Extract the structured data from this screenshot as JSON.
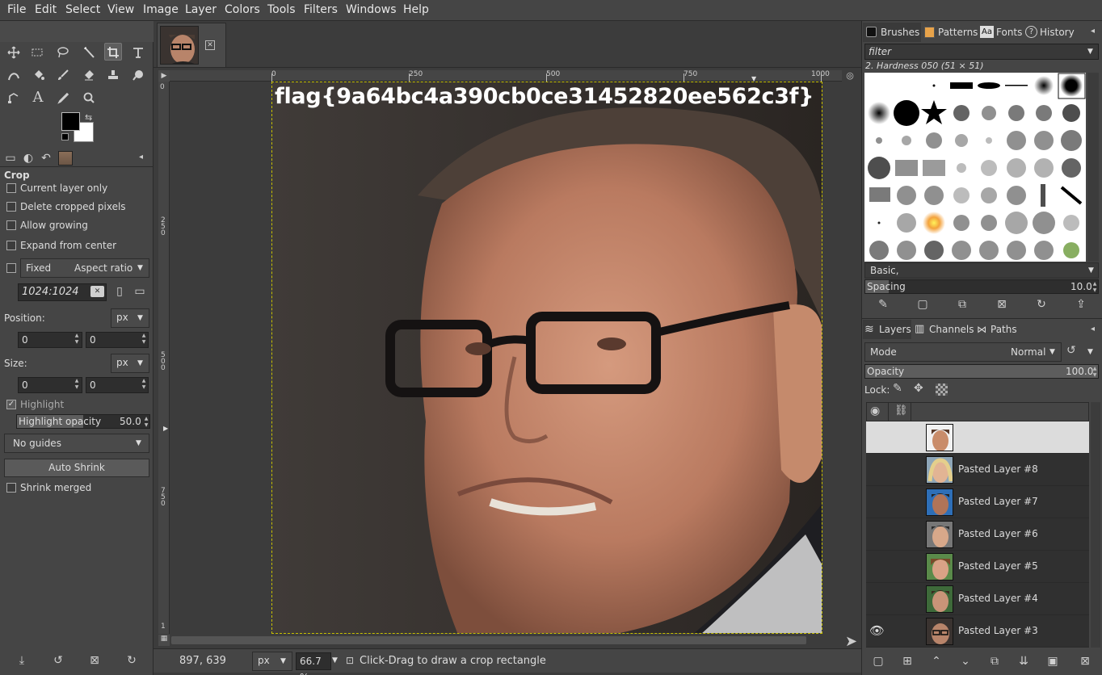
{
  "menubar": {
    "items": [
      "File",
      "Edit",
      "Select",
      "View",
      "Image",
      "Layer",
      "Colors",
      "Tools",
      "Filters",
      "Windows",
      "Help"
    ]
  },
  "toolbox": {
    "tool_rows": [
      [
        "move-icon",
        "rect-select-icon",
        "lasso-icon",
        "fuzzy-select-icon",
        "crop-icon",
        "unified-transform-icon"
      ],
      [
        "warp-icon",
        "bucket-fill-icon",
        "paintbrush-icon",
        "eraser-icon",
        "clone-icon",
        "smudge-icon"
      ],
      [
        "paths-icon",
        "text-icon",
        "color-picker-icon",
        "zoom-icon"
      ]
    ],
    "fg_color": "#000000",
    "bg_color": "#ffffff"
  },
  "tool_options": {
    "title": "Crop",
    "current_layer_only": "Current layer only",
    "delete_cropped_pixels": "Delete cropped pixels",
    "allow_growing": "Allow growing",
    "expand_from_center": "Expand from center",
    "fixed_label": "Fixed",
    "aspect_ratio": "Aspect ratio",
    "ratio_value": "1024:1024",
    "position_label": "Position:",
    "position_unit": "px",
    "position_x": "0",
    "position_y": "0",
    "size_label": "Size:",
    "size_unit": "px",
    "size_w": "0",
    "size_h": "0",
    "highlight": "Highlight",
    "highlight_opacity_label": "Highlight opacity",
    "highlight_opacity_value": "50.0",
    "guides": "No guides",
    "auto_shrink": "Auto Shrink",
    "shrink_merged": "Shrink merged",
    "highlight_checked": true
  },
  "canvas": {
    "flag_text": "flag{9a64bc4a390cb0ce31452820ee562c3f}",
    "ruler_h": [
      "0",
      "250",
      "500",
      "750",
      "1000"
    ],
    "ruler_v": [
      "0",
      "250",
      "500",
      "750",
      "1"
    ]
  },
  "status": {
    "coords": "897, 639",
    "unit": "px",
    "zoom": "66.7 %",
    "message": "Click-Drag to draw a crop rectangle"
  },
  "brushes_panel": {
    "tabs": [
      "Brushes",
      "Patterns",
      "Fonts",
      "History"
    ],
    "filter_placeholder": "filter",
    "brush_name": "2. Hardness 050 (51 × 51)",
    "preset": "Basic,",
    "spacing_label": "Spacing",
    "spacing_value": "10.0"
  },
  "layers_panel": {
    "tabs": [
      "Layers",
      "Channels",
      "Paths"
    ],
    "mode_label": "Mode",
    "mode_value": "Normal",
    "opacity_label": "Opacity",
    "opacity_value": "100.0",
    "lock_label": "Lock:",
    "layers": [
      {
        "name": "",
        "selected": true,
        "visible": false
      },
      {
        "name": "Pasted Layer #8",
        "selected": false,
        "visible": false
      },
      {
        "name": "Pasted Layer #7",
        "selected": false,
        "visible": false
      },
      {
        "name": "Pasted Layer #6",
        "selected": false,
        "visible": false
      },
      {
        "name": "Pasted Layer #5",
        "selected": false,
        "visible": false
      },
      {
        "name": "Pasted Layer #4",
        "selected": false,
        "visible": false
      },
      {
        "name": "Pasted Layer #3",
        "selected": false,
        "visible": true
      }
    ]
  },
  "colors": {
    "guide_yellow": "#c8c000",
    "panel_bg": "#454545",
    "canvas_bg": "#3c3c3c"
  }
}
